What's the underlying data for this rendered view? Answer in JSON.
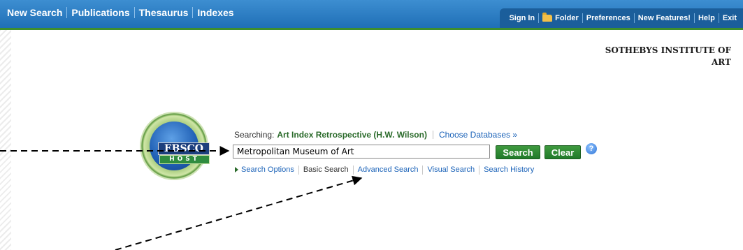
{
  "topbar": {
    "primary_nav": [
      "New Search",
      "Publications",
      "Thesaurus",
      "Indexes"
    ],
    "utility_nav": [
      "Sign In",
      "Folder",
      "Preferences",
      "New Features!",
      "Help",
      "Exit"
    ]
  },
  "institution": {
    "line1": "SOTHEBYS INSTITUTE OF",
    "line2": "ART"
  },
  "logo": {
    "word": "EBSCO",
    "host": "HOST"
  },
  "search": {
    "searching_label": "Searching:",
    "database": "Art Index Retrospective (H.W. Wilson)",
    "choose_databases": "Choose Databases »",
    "query": "Metropolitan Museum of Art",
    "search_button": "Search",
    "clear_button": "Clear",
    "help": "?",
    "links": [
      "Search Options",
      "Basic Search",
      "Advanced Search",
      "Visual Search",
      "Search History"
    ]
  },
  "colors": {
    "nav_blue": "#2a7ec8",
    "accent_green": "#2e7d32",
    "link_blue": "#1a62b8"
  }
}
